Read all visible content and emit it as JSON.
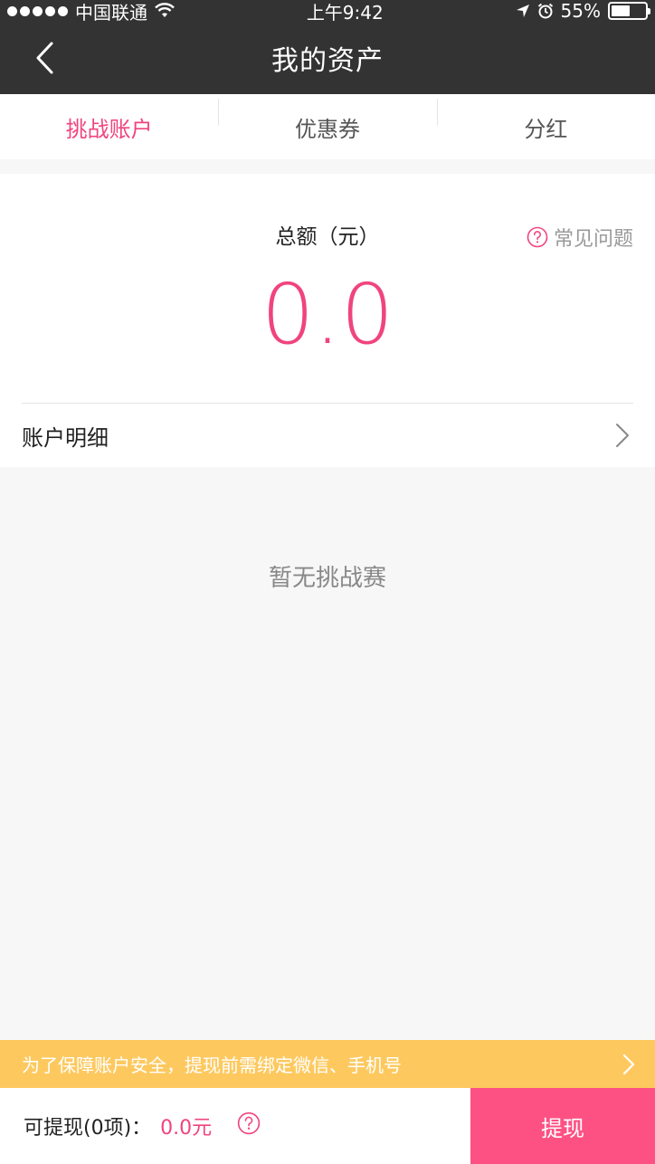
{
  "status": {
    "carrier": "中国联通",
    "time": "上午9:42",
    "battery": "55%",
    "battery_level": 0.55
  },
  "nav": {
    "title": "我的资产"
  },
  "tabs": [
    {
      "label": "挑战账户",
      "active": true
    },
    {
      "label": "优惠券",
      "active": false
    },
    {
      "label": "分红",
      "active": false
    }
  ],
  "summary": {
    "total_label": "总额（元）",
    "faq_label": "常见问题",
    "amount": "0.0",
    "detail_label": "账户明细"
  },
  "empty": {
    "message": "暂无挑战赛"
  },
  "notice": {
    "text": "为了保障账户安全，提现前需绑定微信、手机号"
  },
  "bottom": {
    "withdrawable_label": "可提现(0项)：",
    "withdrawable_value": "0.0元",
    "withdraw_button": "提现"
  },
  "colors": {
    "accent": "#f0447f",
    "nav_bg": "#333333",
    "notice_bg": "#fdc95f",
    "button_bg": "#fd5184"
  }
}
